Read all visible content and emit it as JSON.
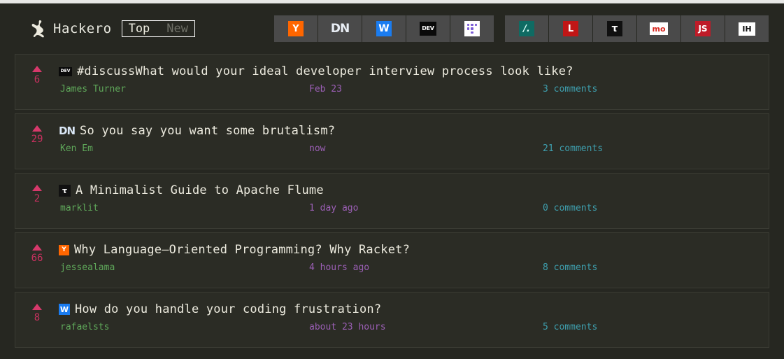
{
  "header": {
    "brand_name": "Hackero",
    "logo_icon": "kangaroo-icon",
    "sort": {
      "top_label": "Top",
      "new_label": "New",
      "active": "Top"
    },
    "source_groups": [
      {
        "name": "group-primary",
        "buttons": [
          {
            "id": "hackernews",
            "label": "Y",
            "icon": "hacker-news-icon",
            "fg": "#ffffff",
            "bg": "#ff6600"
          },
          {
            "id": "designernews",
            "label": "DN",
            "icon": "designer-news-icon",
            "fg": "#e9eef5",
            "bg": "transparent"
          },
          {
            "id": "lobsters-blue",
            "label": "W",
            "icon": "hashnode-icon",
            "fg": "#ffffff",
            "bg": "#1a7cf0"
          },
          {
            "id": "devto",
            "label": "DEV",
            "icon": "dev-to-icon",
            "fg": "#ffffff",
            "bg": "#0a0a0a"
          },
          {
            "id": "producthunt",
            "label": "",
            "icon": "product-hunt-grid-icon",
            "fg": "#7b5cd6",
            "bg": "#ffffff"
          }
        ]
      },
      {
        "name": "group-secondary",
        "buttons": [
          {
            "id": "slashdot",
            "label": "/.",
            "icon": "slashdot-icon",
            "fg": "#d8fff7",
            "bg": "#0f6b63"
          },
          {
            "id": "lobsters",
            "label": "L",
            "icon": "lobsters-icon",
            "fg": "#ffffff",
            "bg": "#c01616"
          },
          {
            "id": "tildes",
            "label": "τ",
            "icon": "tildes-icon",
            "fg": "#ffffff",
            "bg": "#101010"
          },
          {
            "id": "mozilla",
            "label": "mo",
            "icon": "mozilla-hacks-icon",
            "fg": "#d7261e",
            "bg": "#ffffff"
          },
          {
            "id": "echojs",
            "label": "JS",
            "icon": "echo-js-icon",
            "fg": "#ffffff",
            "bg": "#bf1b28"
          },
          {
            "id": "indiehackers",
            "label": "IH",
            "icon": "indie-hackers-icon",
            "fg": "#111111",
            "bg": "#ffffff"
          }
        ]
      }
    ]
  },
  "stories": [
    {
      "votes": "6",
      "source_label": "DEV",
      "source_icon": "dev-to-icon",
      "source_class": "rb-dev",
      "title": "#discussWhat would your ideal developer interview process look like?",
      "author": "James Turner",
      "posted": "Feb 23",
      "comments": "3 comments"
    },
    {
      "votes": "29",
      "source_label": "DN",
      "source_icon": "designer-news-icon",
      "source_class": "rb-dn",
      "title": "So you say you want some brutalism?",
      "author": "Ken Em",
      "posted": "now",
      "comments": "21 comments"
    },
    {
      "votes": "2",
      "source_label": "τ",
      "source_icon": "tildes-icon",
      "source_class": "rb-ti",
      "title": "A Minimalist Guide to Apache Flume",
      "author": "marklit",
      "posted": "1 day ago",
      "comments": "0 comments"
    },
    {
      "votes": "66",
      "source_label": "Y",
      "source_icon": "hacker-news-icon",
      "source_class": "rb-hn",
      "title": "Why Language–Oriented Programming? Why Racket?",
      "author": "jessealama",
      "posted": "4 hours ago",
      "comments": "8  comments"
    },
    {
      "votes": "8",
      "source_label": "W",
      "source_icon": "hashnode-icon",
      "source_class": "rb-lo",
      "title": "How do you handle your coding frustration?",
      "author": "rafaelsts",
      "posted": "about 23 hours",
      "comments": "5 comments"
    }
  ],
  "colors": {
    "page_bg": "#262721",
    "card_bg": "#2b2c25",
    "card_border": "#3a3b33",
    "title": "#eceade",
    "author": "#5fa85a",
    "posted": "#9b5fb5",
    "comments": "#3e9fae",
    "vote": "#c8315f"
  }
}
